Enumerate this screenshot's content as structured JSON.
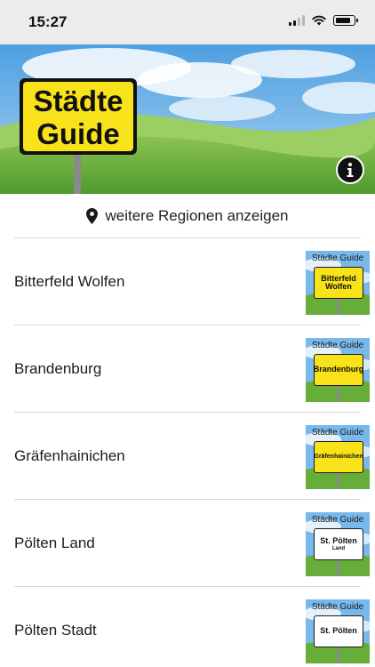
{
  "status_bar": {
    "time": "15:27"
  },
  "banner": {
    "sign_line1": "Städte",
    "sign_line2": "Guide",
    "info_icon": "info-icon"
  },
  "regions": {
    "icon": "location-pin-icon",
    "label": "weitere Regionen anzeigen"
  },
  "colors": {
    "sign_yellow": "#f8e21a",
    "sky_blue": "#6fb2e6",
    "grass_green": "#5ea534",
    "divider": "#d8d8d8"
  },
  "cities": [
    {
      "name": "Bitterfeld Wolfen",
      "thumb_header": "Städte Guide",
      "thumb_lines": [
        "Bitterfeld",
        "Wolfen"
      ],
      "thumb_sub": "",
      "sign_color": "yellow"
    },
    {
      "name": "Brandenburg",
      "thumb_header": "Städte Guide",
      "thumb_lines": [
        "Brandenburg"
      ],
      "thumb_sub": "",
      "sign_color": "yellow"
    },
    {
      "name": "Gräfenhainichen",
      "thumb_header": "Städte Guide",
      "thumb_lines": [
        "Gräfenhainichen"
      ],
      "thumb_sub": "",
      "sign_color": "yellow"
    },
    {
      "name": "Pölten Land",
      "thumb_header": "Städte Guide",
      "thumb_lines": [
        "St. Pölten"
      ],
      "thumb_sub": "Land",
      "sign_color": "white"
    },
    {
      "name": "Pölten Stadt",
      "thumb_header": "Städte Guide",
      "thumb_lines": [
        "St. Pölten"
      ],
      "thumb_sub": "",
      "sign_color": "white"
    }
  ]
}
